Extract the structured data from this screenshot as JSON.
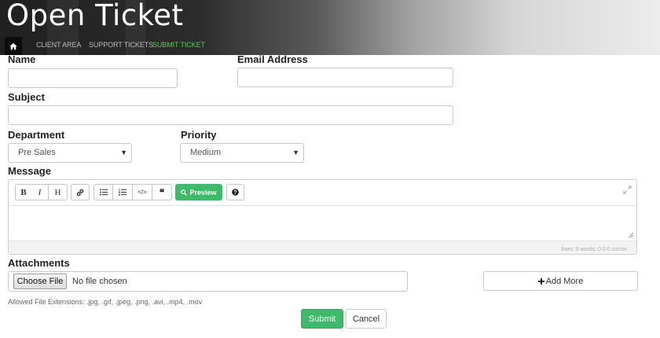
{
  "header": {
    "title": "Open Ticket",
    "breadcrumbs": [
      "CLIENT AREA",
      "SUPPORT TICKETS",
      "SUBMIT TICKET"
    ],
    "home_icon": "home-icon"
  },
  "form": {
    "name_label": "Name",
    "name_value": "",
    "email_label": "Email Address",
    "email_value": "",
    "subject_label": "Subject",
    "subject_value": "",
    "department_label": "Department",
    "department_value": "Pre Sales",
    "priority_label": "Priority",
    "priority_value": "Medium",
    "message_label": "Message",
    "message_value": "",
    "attachments_label": "Attachments",
    "choose_file_label": "Choose File",
    "no_file_text": "No file chosen",
    "add_more_label": "Add More",
    "allowed_extensions": "Allowed File Extensions: .jpg, .gif, .jpeg, .png, .avi, .mp4, .mov",
    "submit_label": "Submit",
    "cancel_label": "Cancel"
  },
  "editor": {
    "toolbar": {
      "bold": "B",
      "italic": "I",
      "heading": "H",
      "preview": "Preview"
    },
    "status": "lines: 0   words: 0   0:0   cursor"
  },
  "colors": {
    "accent_green": "#3fba6a",
    "active_crumb": "#5ec85e",
    "header_dark": "#202020"
  }
}
